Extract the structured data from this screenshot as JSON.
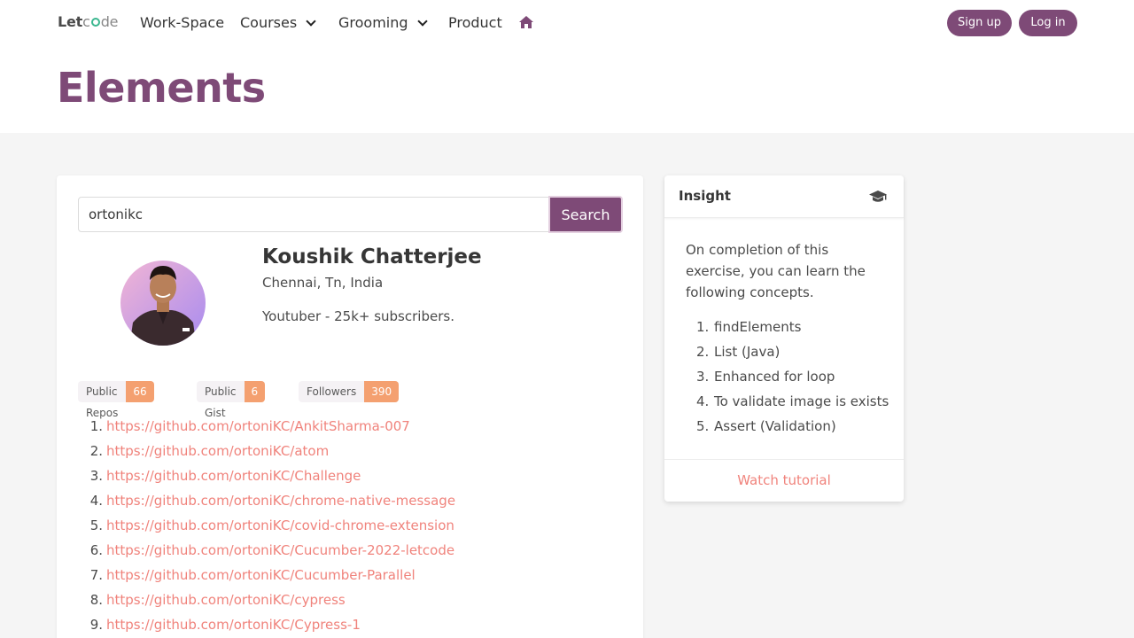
{
  "nav": {
    "brand_let": "Let",
    "brand_c": "c",
    "brand_de": "de",
    "items": [
      {
        "label": "Work-Space"
      },
      {
        "label": "Courses"
      },
      {
        "label": "Grooming"
      },
      {
        "label": "Product"
      }
    ],
    "signup_label": "Sign up",
    "login_label": "Log in"
  },
  "hero": {
    "title": "Elements"
  },
  "search": {
    "value": "ortonikc",
    "button_label": "Search"
  },
  "profile": {
    "name": "Koushik Chatterjee",
    "location": "Chennai, Tn, India",
    "bio": "Youtuber - 25k+ subscribers."
  },
  "stats": [
    {
      "label": "Public Repos",
      "count": "66"
    },
    {
      "label": "Public Gist",
      "count": "6"
    },
    {
      "label": "Followers",
      "count": "390"
    }
  ],
  "repos": [
    {
      "num": "1.",
      "url": "https://github.com/ortoniKC/AnkitSharma-007"
    },
    {
      "num": "2.",
      "url": "https://github.com/ortoniKC/atom"
    },
    {
      "num": "3.",
      "url": "https://github.com/ortoniKC/Challenge"
    },
    {
      "num": "4.",
      "url": "https://github.com/ortoniKC/chrome-native-message"
    },
    {
      "num": "5.",
      "url": "https://github.com/ortoniKC/covid-chrome-extension"
    },
    {
      "num": "6.",
      "url": "https://github.com/ortoniKC/Cucumber-2022-letcode"
    },
    {
      "num": "7.",
      "url": "https://github.com/ortoniKC/Cucumber-Parallel"
    },
    {
      "num": "8.",
      "url": "https://github.com/ortoniKC/cypress"
    },
    {
      "num": "9.",
      "url": "https://github.com/ortoniKC/Cypress-1"
    }
  ],
  "insight": {
    "title": "Insight",
    "description": "On completion of this exercise, you can learn the following concepts.",
    "concepts": [
      {
        "num": "1.",
        "text": "findElements"
      },
      {
        "num": "2.",
        "text": "List (Java)"
      },
      {
        "num": "3.",
        "text": "Enhanced for loop"
      },
      {
        "num": "4.",
        "text": "To validate image is exists"
      },
      {
        "num": "5.",
        "text": "Assert (Validation)"
      }
    ],
    "footer_link": "Watch tutorial"
  },
  "colors": {
    "brand": "#7e4a77",
    "link": "#f0837c",
    "tag_count": "#f4a070"
  }
}
